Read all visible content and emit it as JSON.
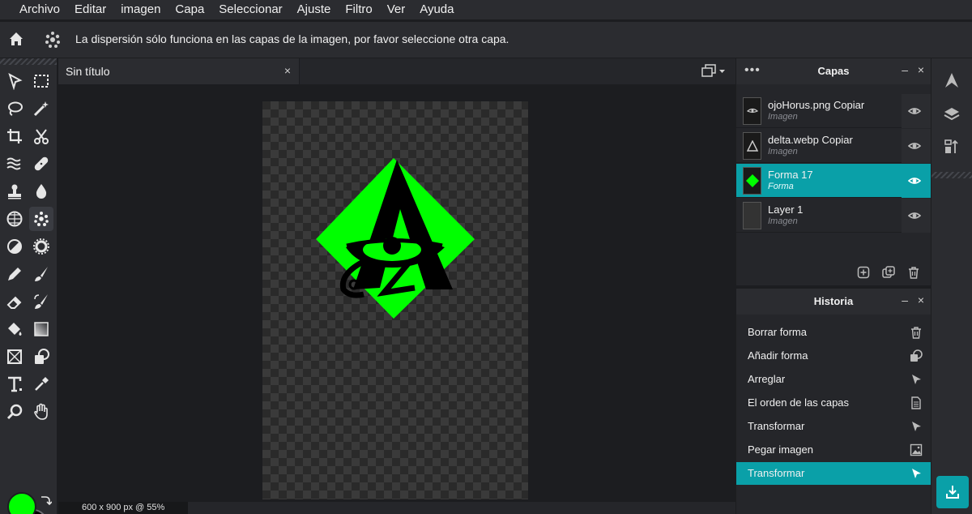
{
  "menu": [
    "Archivo",
    "Editar",
    "imagen",
    "Capa",
    "Seleccionar",
    "Ajuste",
    "Filtro",
    "Ver",
    "Ayuda"
  ],
  "options_bar": {
    "message": "La dispersión sólo funciona en las capas de la imagen, por favor seleccione otra capa."
  },
  "document": {
    "tab_title": "Sin título",
    "tab_close": "×",
    "status": "600 x 900 px @ 55%"
  },
  "colors": {
    "accent": "#0aa0a8",
    "foreground": "#00ff00",
    "background": "#000000"
  },
  "layers_panel": {
    "title": "Capas",
    "more": "•••",
    "minimize": "–",
    "close": "×",
    "items": [
      {
        "name": "ojoHorus.png Copiar",
        "kind": "Imagen",
        "selected": false
      },
      {
        "name": "delta.webp Copiar",
        "kind": "Imagen",
        "selected": false
      },
      {
        "name": "Forma 17",
        "kind": "Forma",
        "selected": true
      },
      {
        "name": "Layer 1",
        "kind": "Imagen",
        "selected": false
      }
    ]
  },
  "history_panel": {
    "title": "Historia",
    "minimize": "–",
    "close": "×",
    "items": [
      {
        "label": "Borrar forma",
        "icon": "trash-icon"
      },
      {
        "label": "Añadir forma",
        "icon": "shape-icon"
      },
      {
        "label": "Arreglar",
        "icon": "arrow-icon"
      },
      {
        "label": "El orden de las capas",
        "icon": "doc-icon"
      },
      {
        "label": "Transformar",
        "icon": "arrow-icon"
      },
      {
        "label": "Pegar imagen",
        "icon": "image-icon"
      },
      {
        "label": "Transformar",
        "icon": "arrow-icon",
        "selected": true
      }
    ]
  }
}
